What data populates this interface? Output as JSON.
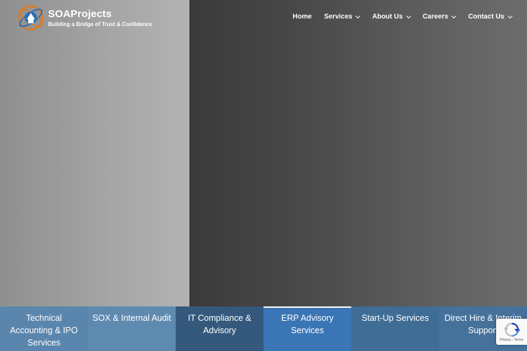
{
  "brand": {
    "name": "SOAProjects",
    "tagline": "Building a Bridge of Trust & Confidence"
  },
  "nav": {
    "items": [
      {
        "label": "Home",
        "dropdown": false
      },
      {
        "label": "Services",
        "dropdown": true
      },
      {
        "label": "About Us",
        "dropdown": true
      },
      {
        "label": "Careers",
        "dropdown": true
      },
      {
        "label": "Contact Us",
        "dropdown": true
      }
    ]
  },
  "service_tabs": [
    {
      "label": "Technical\nAccounting & IPO\nServices"
    },
    {
      "label": "SOX & Internal Audit"
    },
    {
      "label": "IT Compliance &\nAdvisory"
    },
    {
      "label": "ERP Advisory\nServices",
      "active": true
    },
    {
      "label": "Start-Up Services"
    },
    {
      "label": "Direct Hire & Interim\nSupport"
    }
  ],
  "recaptcha": {
    "terms": "Privacy - Terms",
    "icon": "recaptcha-icon"
  },
  "colors": {
    "tab_active": "#3a76b6",
    "tab_dark": "#34597c",
    "tab_light": "#5a86ad",
    "text": "#ffffff"
  }
}
